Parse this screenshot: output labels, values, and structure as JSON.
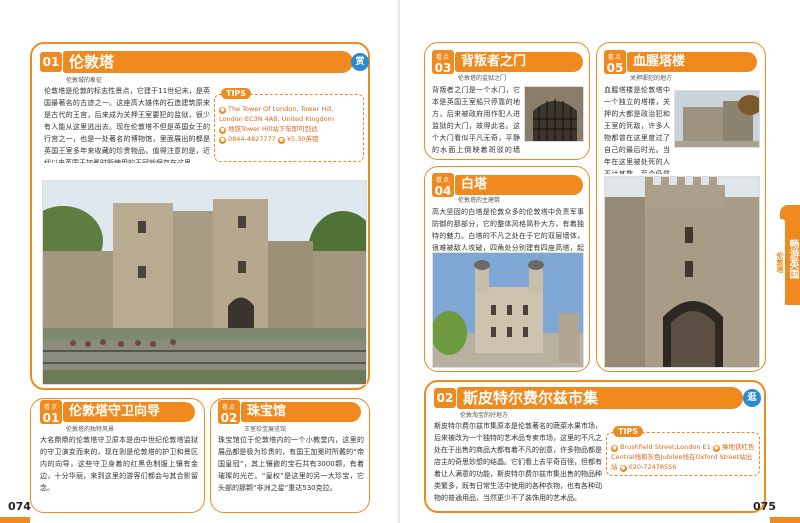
{
  "left": {
    "section1": {
      "badge_num": "01",
      "title": "伦敦塔",
      "subtitle": "伦敦城的象征",
      "icon_char": "赏",
      "text": "伦敦塔是伦敦的标志性景点，它建于11世纪末，是英国最著名的古迹之一。这座高大雄伟的石造建筑原来是古代的王宫，后来成为关押王室要犯的监狱，很少有人能从这里逃出去。现在伦敦塔不但是英国女王的行宫之一，也是一处著名的博物馆，里面展出的都是英国王室多年来收藏的珍贵物品，值得注意的是，近代以来英国王加冕时所使用的王冠就保存在这里。",
      "tips": {
        "label": "TIPS",
        "address": "The Tower Of London, Tower Hill, London EC3N 4AB, United Kingdom",
        "transport": "地铁Tower Hill站下车即可到达",
        "phone": "0844-4827777",
        "price": "¥5.30英镑"
      }
    },
    "section2": {
      "badge_tag": "看点",
      "badge_num": "01",
      "title": "伦敦塔守卫向导",
      "subtitle": "伦敦塔的独特风景",
      "text": "大名鼎鼎的伦敦塔守卫原本是由中世纪伦敦塔监狱的守卫演变而来的，现在则是伦敦塔的护卫和景区内的向导，这些守卫身着的红黑色制服上镶有金边，十分华丽，来到这里的游客们都会与其合影留念。"
    },
    "section3": {
      "badge_tag": "看点",
      "badge_num": "02",
      "title": "珠宝馆",
      "subtitle": "王室珍宝展览馆",
      "text": "珠宝馆位于伦敦塔内的一个小教堂内，这里的展品都是极为珍贵的，有国王加冕时所戴的“帝国皇冠”，其上镶嵌的宝石共有3000颗，有着璀璨的光芒。“皇权”是这里的另一大珍宝，它头部的那颗“非洲之星”重达530克拉。"
    },
    "page_number": "074"
  },
  "right": {
    "section_a": {
      "badge_tag": "看点",
      "badge_num": "03",
      "title": "背叛者之门",
      "subtitle": "伦敦塔的监狱之门",
      "text": "背叛者之门是一个水门，它本是英国王室船只停靠的地方，后来被政府用作犯人进监狱的大门，故得此名。这个大门看似平凡无奇，平静的水面上倒映着斑驳的墙壁，但却不知有多少人曾从这里经过。"
    },
    "section_b": {
      "badge_tag": "看点",
      "badge_num": "05",
      "title": "血腥塔楼",
      "subtitle": "关押罪犯的地方",
      "text": "血腥塔楼是伦敦塔中一个独立的塔楼，关押的大都是政治犯和王室的死敌，许多人物都曾在这里度过了自己的最后时光。当年在这里被处死的人不计其数，至今仍然保存着当时的刑具，那种阴森的气息至今仍让人感到不寒而栗。"
    },
    "section_c": {
      "badge_tag": "看点",
      "badge_num": "04",
      "title": "白塔",
      "subtitle": "伦敦塔的主建筑",
      "text": "高大坚固的白塔是伦敦众多的伦敦塔中负责军事防御的那部分，它的整体风格简朴大方，有着独特的魅力。白塔的不凡之处在于它的双层墙体，很难被敌人攻破，四角处分别建有四座高塔，起着观察放哨的作用。"
    },
    "section_d": {
      "badge_num": "02",
      "title": "斯皮特尔费尔兹市集",
      "subtitle": "伦敦淘宝的好地方",
      "icon_char": "逛",
      "text": "斯皮特尔费尔兹市集原本是伦敦著名的蔬菜水果市场，后来被改为一个独特的艺术品专卖市场，这里的不凡之处在于出售的商品大都有着不凡的创意，许多物品都是店主的奇思妙想的结晶。它们看上去平奇百怪，但都有着让人满意的功能，斯皮特尔费尔兹市集出售的物品种类繁多，既有日常生活中使用的各种衣物，也有各种动物的普通用品，当然更少不了装饰用的艺术品。",
      "tips": {
        "label": "TIPS",
        "address": "Brushfield Street,London E1",
        "transport": "乘地铁红色Central线和灰色Jubilee线在Oxford Street站出站",
        "phone": "020-72478556"
      }
    },
    "side_tab": {
      "main": "畅游英国",
      "sub": "伦敦塔"
    },
    "page_number": "075"
  },
  "colors": {
    "accent": "#f08a1e",
    "badge_blue": "#2a8bd3"
  }
}
